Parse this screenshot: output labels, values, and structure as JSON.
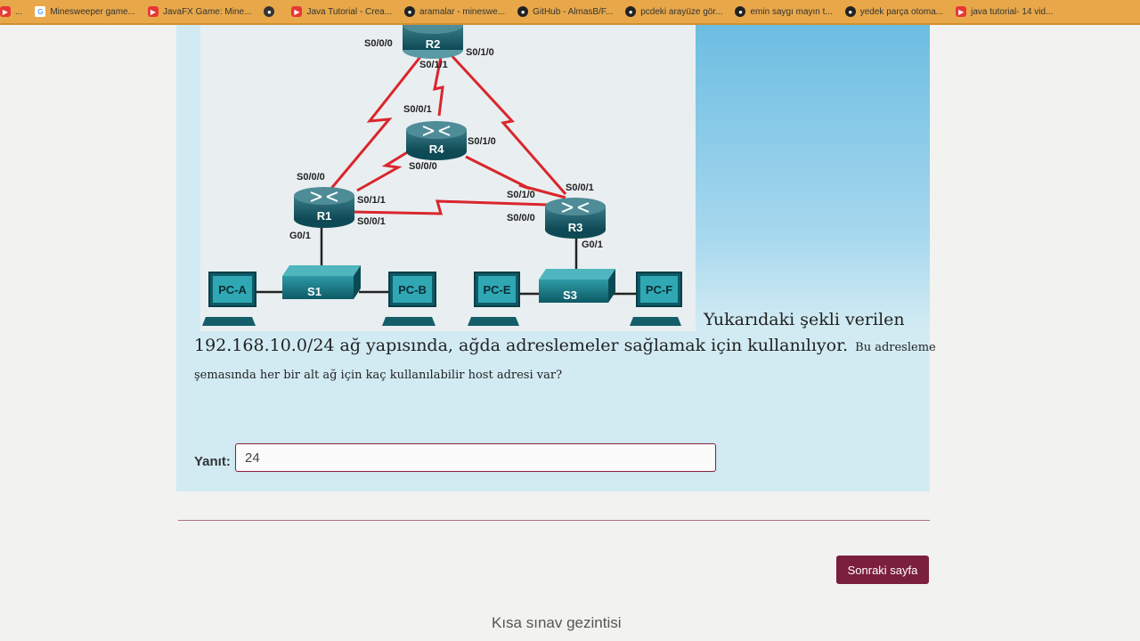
{
  "bookmarks": [
    {
      "label": "...",
      "icon": "youtube-icon"
    },
    {
      "label": "Minesweeper game...",
      "icon": "google-icon"
    },
    {
      "label": "JavaFX Game: Mine...",
      "icon": "youtube-icon"
    },
    {
      "label": "",
      "icon": "circle-icon"
    },
    {
      "label": "Java Tutorial - Crea...",
      "icon": "youtube-icon"
    },
    {
      "label": "aramalar - mineswe...",
      "icon": "github-icon"
    },
    {
      "label": "GitHub - AlmasB/F...",
      "icon": "github-icon"
    },
    {
      "label": "pcdeki arayüze gör...",
      "icon": "github-icon"
    },
    {
      "label": "emin saygı mayın t...",
      "icon": "github-icon"
    },
    {
      "label": "yedek parça otoma...",
      "icon": "github-icon"
    },
    {
      "label": "java tutorial- 14 vid...",
      "icon": "youtube-icon"
    }
  ],
  "diagram": {
    "routers": [
      "R2",
      "R4",
      "R1",
      "R3"
    ],
    "switches": [
      "S1",
      "S3"
    ],
    "pcs": [
      "PC-A",
      "PC-B",
      "PC-E",
      "PC-F"
    ],
    "ports": {
      "r2_left": "S0/0/0",
      "r2_right": "S0/1/0",
      "r2_bottom": "S0/1/1",
      "r4_top": "S0/0/1",
      "r4_right": "S0/1/0",
      "r4_bottom": "S0/0/0",
      "r1_top": "S0/0/0",
      "r1_right_top": "S0/1/1",
      "r1_right_bottom": "S0/0/1",
      "r1_bottom": "G0/1",
      "r3_top": "S0/0/1",
      "r3_left_top": "S0/1/0",
      "r3_left_bottom": "S0/0/0",
      "r3_bottom": "G0/1"
    }
  },
  "question": {
    "part1": "Yukarıdaki şekli verilen",
    "part2": "192.168.10.0/24 ağ yapısında, ağda adreslemeler sağlamak için kullanılıyor.",
    "part3": "Bu adresleme",
    "part4": "şemasında her bir alt ağ için kaç kullanılabilir host adresi var?"
  },
  "answer": {
    "label": "Yanıt:",
    "value": "24"
  },
  "next_button": "Sonraki sayfa",
  "quiz_nav": "Kısa sınav gezintisi"
}
